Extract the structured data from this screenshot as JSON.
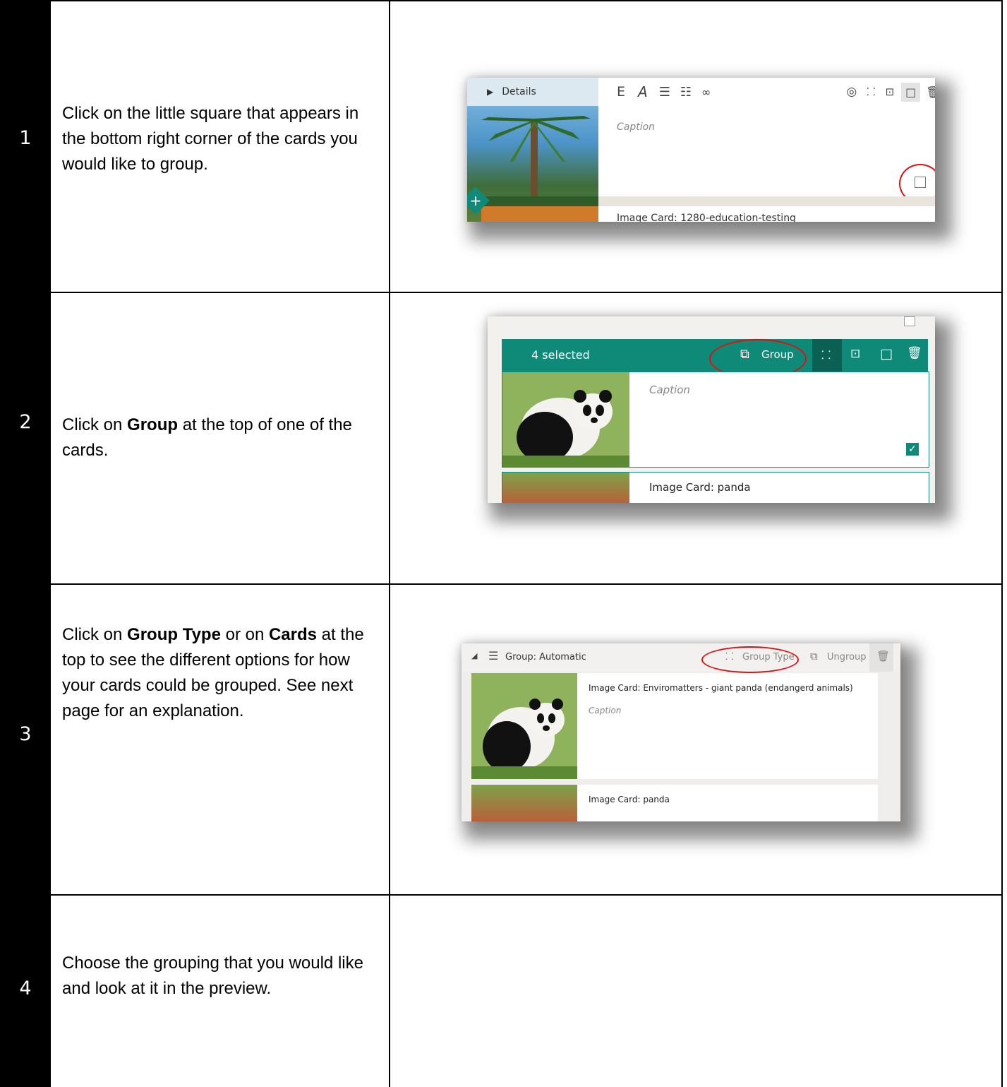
{
  "steps": [
    {
      "number": "1",
      "text_parts": [
        "Click on the little square that appears in the bottom right corner of the cards you would like to group."
      ],
      "shot": {
        "details_label": "Details",
        "caption_placeholder": "Caption",
        "next_card_label": "Image Card: 1280-education-testing"
      }
    },
    {
      "number": "2",
      "text_a": "Click on ",
      "text_b": "Group",
      "text_c": " at the top of one of the cards.",
      "shot": {
        "selected_label": "4 selected",
        "group_button": "Group",
        "caption_placeholder": "Caption",
        "next_card_label": "Image Card: panda"
      }
    },
    {
      "number": "3",
      "text_a": "Click on ",
      "text_b": "Group Type",
      "text_c": " or on ",
      "text_d": "Cards",
      "text_e": " at the top to see the different options for how your cards could be grouped. See next page for an explanation.",
      "shot": {
        "group_label": "Group: Automatic",
        "group_type_button": "Group Type",
        "ungroup_button": "Ungroup",
        "card_title": "Image Card: Enviromatters - giant panda (endangerd animals)",
        "caption_placeholder": "Caption",
        "next_card_label": "Image Card: panda"
      }
    },
    {
      "number": "4",
      "text_parts": [
        "Choose the grouping that you would like and look at it in the preview."
      ]
    }
  ],
  "colors": {
    "teal": "#0f8a78",
    "highlight_red": "#d11111",
    "rail": "#000000"
  }
}
